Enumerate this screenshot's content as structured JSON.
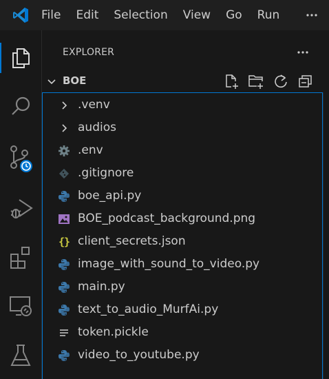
{
  "menu": {
    "items": [
      "File",
      "Edit",
      "Selection",
      "View",
      "Go",
      "Run"
    ],
    "more_icon": "ellipsis-icon"
  },
  "activity_bar": {
    "items": [
      {
        "name": "explorer",
        "icon": "files-icon",
        "active": true
      },
      {
        "name": "search",
        "icon": "search-icon"
      },
      {
        "name": "source-control",
        "icon": "source-control-icon",
        "badge_icon": "clock-icon"
      },
      {
        "name": "run-debug",
        "icon": "run-debug-icon"
      },
      {
        "name": "extensions",
        "icon": "extensions-icon"
      },
      {
        "name": "remote-explorer",
        "icon": "remote-explorer-icon"
      },
      {
        "name": "testing",
        "icon": "beaker-icon"
      }
    ]
  },
  "sidebar": {
    "title": "EXPLORER",
    "more_icon": "ellipsis-icon",
    "folder": {
      "name": "BOE",
      "expanded": true,
      "actions": [
        "new-file-icon",
        "new-folder-icon",
        "refresh-icon",
        "collapse-all-icon"
      ]
    },
    "items": [
      {
        "label": ".venv",
        "type": "folder",
        "icon": "chevron-right-icon"
      },
      {
        "label": "audios",
        "type": "folder",
        "icon": "chevron-right-icon"
      },
      {
        "label": ".env",
        "type": "file",
        "icon": "gear-icon"
      },
      {
        "label": ".gitignore",
        "type": "file",
        "icon": "git-icon"
      },
      {
        "label": "boe_api.py",
        "type": "file",
        "icon": "python-icon"
      },
      {
        "label": "BOE_podcast_background.png",
        "type": "file",
        "icon": "image-icon"
      },
      {
        "label": "client_secrets.json",
        "type": "file",
        "icon": "json-icon"
      },
      {
        "label": "image_with_sound_to_video.py",
        "type": "file",
        "icon": "python-icon"
      },
      {
        "label": "main.py",
        "type": "file",
        "icon": "python-icon"
      },
      {
        "label": "text_to_audio_MurfAi.py",
        "type": "file",
        "icon": "python-icon"
      },
      {
        "label": "token.pickle",
        "type": "file",
        "icon": "text-file-icon"
      },
      {
        "label": "video_to_youtube.py",
        "type": "file",
        "icon": "python-icon"
      }
    ]
  },
  "colors": {
    "accent": "#0078d4",
    "background": "#181818",
    "titlebar": "#1f1f1f",
    "text": "#cccccc",
    "python_blue": "#3c78aa",
    "python_yellow": "#ffd43b",
    "json_yellow": "#cbcb41",
    "image_purple": "#a074c4",
    "gear_gray": "#6d8086",
    "git_gray": "#41535b"
  }
}
